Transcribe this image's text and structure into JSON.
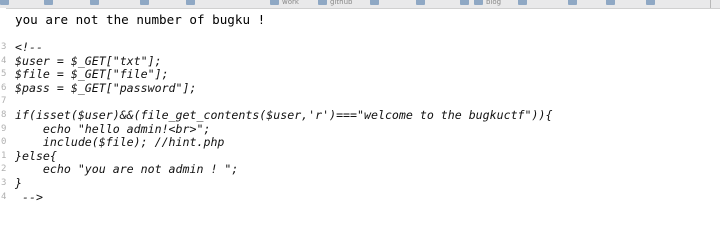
{
  "bookmarks_bar": {
    "items": [
      {
        "label": "",
        "icon": "folder-icon"
      },
      {
        "label": "",
        "icon": "folder-icon"
      },
      {
        "label": "",
        "icon": "folder-icon"
      },
      {
        "label": "",
        "icon": "folder-icon"
      },
      {
        "label": "",
        "icon": "folder-icon"
      },
      {
        "label": "work",
        "icon": "folder-icon"
      },
      {
        "label": "github",
        "icon": "folder-icon"
      },
      {
        "label": "",
        "icon": "folder-icon"
      },
      {
        "label": "",
        "icon": "folder-icon"
      },
      {
        "label": "",
        "icon": "folder-icon"
      },
      {
        "label": "blog",
        "icon": "folder-icon"
      },
      {
        "label": "",
        "icon": "folder-icon"
      },
      {
        "label": "",
        "icon": "folder-icon"
      },
      {
        "label": "",
        "icon": "folder-icon"
      },
      {
        "label": "",
        "icon": "folder-icon"
      }
    ]
  },
  "page": {
    "message": "you are not the number of bugku !"
  },
  "source": {
    "lines": [
      {
        "num": "3",
        "text": "<!--"
      },
      {
        "num": "4",
        "text": "$user = $_GET[\"txt\"];"
      },
      {
        "num": "5",
        "text": "$file = $_GET[\"file\"];"
      },
      {
        "num": "6",
        "text": "$pass = $_GET[\"password\"];"
      },
      {
        "num": "7",
        "text": ""
      },
      {
        "num": "8",
        "text": "if(isset($user)&&(file_get_contents($user,'r')===\"welcome to the bugkuctf\")){"
      },
      {
        "num": "9",
        "text": "    echo \"hello admin!<br>\";"
      },
      {
        "num": "0",
        "text": "    include($file); //hint.php"
      },
      {
        "num": "1",
        "text": "}else{"
      },
      {
        "num": "2",
        "text": "    echo \"you are not admin ! \";"
      },
      {
        "num": "3",
        "text": "}"
      },
      {
        "num": "4",
        "text": " -->"
      }
    ]
  }
}
